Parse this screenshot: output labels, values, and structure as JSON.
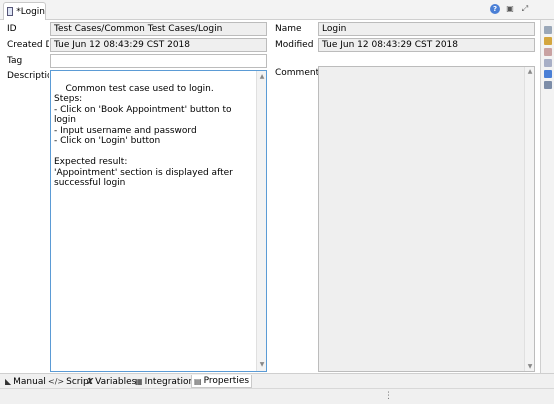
{
  "editor_tab": {
    "title": "*Login"
  },
  "fields": {
    "id": {
      "label": "ID",
      "value": "Test Cases/Common Test Cases/Login"
    },
    "name": {
      "label": "Name",
      "value": "Login"
    },
    "created": {
      "label": "Created Da",
      "value": "Tue Jun 12 08:43:29 CST 2018"
    },
    "modified": {
      "label": "Modified D",
      "value": "Tue Jun 12 08:43:29 CST 2018"
    },
    "tag": {
      "label": "Tag",
      "value": ""
    },
    "description": {
      "label": "Description",
      "value": "Common test case used to login.\nSteps:\n- Click on 'Book Appointment' button to login\n- Input username and password\n- Click on 'Login' button\n\nExpected result:\n'Appointment' section is displayed after successful login"
    },
    "comment": {
      "label": "Comment",
      "value": ""
    }
  },
  "bottom_tabs": [
    {
      "label": "Manual",
      "icon": "manual-icon"
    },
    {
      "label": "Script",
      "icon": "script-icon"
    },
    {
      "label": "Variables",
      "icon": "variables-icon"
    },
    {
      "label": "Integration",
      "icon": "integration-icon"
    },
    {
      "label": "Properties",
      "icon": "properties-icon",
      "active": true
    }
  ],
  "icons": {
    "window_controls": [
      "help-icon",
      "restore-icon",
      "maximize-icon"
    ],
    "side_toolbar": [
      "tool-icon-1",
      "tool-icon-2",
      "tool-icon-3",
      "tool-icon-4",
      "tool-icon-5",
      "tool-icon-6"
    ]
  },
  "colors": {
    "focus_border": "#5b9bd5",
    "readonly_bg": "#efefef"
  }
}
